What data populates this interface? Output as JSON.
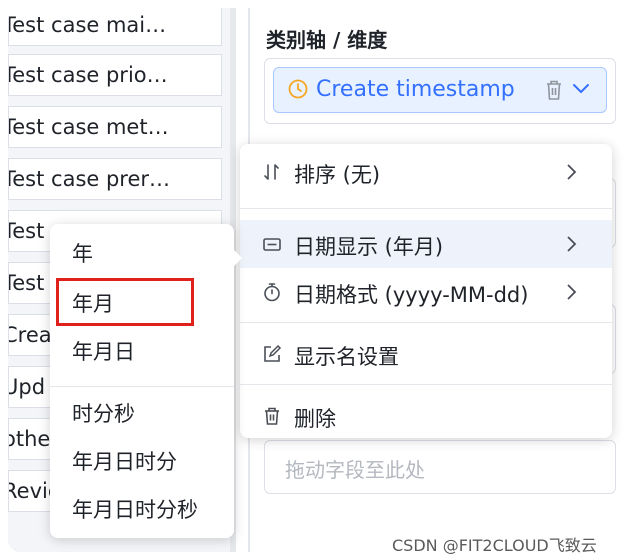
{
  "field_list": {
    "items": [
      "Test case mai…",
      "Test case prio…",
      "Test case met…",
      "Test case prer…",
      "Test",
      "Test",
      "Crea",
      "Upd",
      "othe",
      "Revie"
    ]
  },
  "config_panel": {
    "axis_title": "类别轴 / 维度",
    "dimension_chip": {
      "label": "Create timestamp",
      "icon": "clock-icon",
      "accent_color": "#3370ff",
      "icon_color": "#f5a623"
    },
    "drop_placeholder": "拖动字段至此处"
  },
  "context_menu": {
    "items": [
      {
        "label": "排序 (无)",
        "icon": "sort-icon",
        "has_submenu": true
      },
      {
        "label": "日期显示 (年月)",
        "icon": "calendar-display-icon",
        "has_submenu": true,
        "active": true
      },
      {
        "label": "日期格式 (yyyy-MM-dd)",
        "icon": "stopwatch-icon",
        "has_submenu": true
      },
      {
        "label": "显示名设置",
        "icon": "edit-icon",
        "has_submenu": false
      },
      {
        "label": "删除",
        "icon": "trash-icon",
        "has_submenu": false
      }
    ]
  },
  "date_display_submenu": {
    "options": [
      "年",
      "年月",
      "年月日",
      "时分秒",
      "年月日时分",
      "年月日时分秒"
    ],
    "selected": "年月",
    "highlight_color": "#e0201a"
  },
  "watermark": "CSDN @FIT2CLOUD飞致云"
}
